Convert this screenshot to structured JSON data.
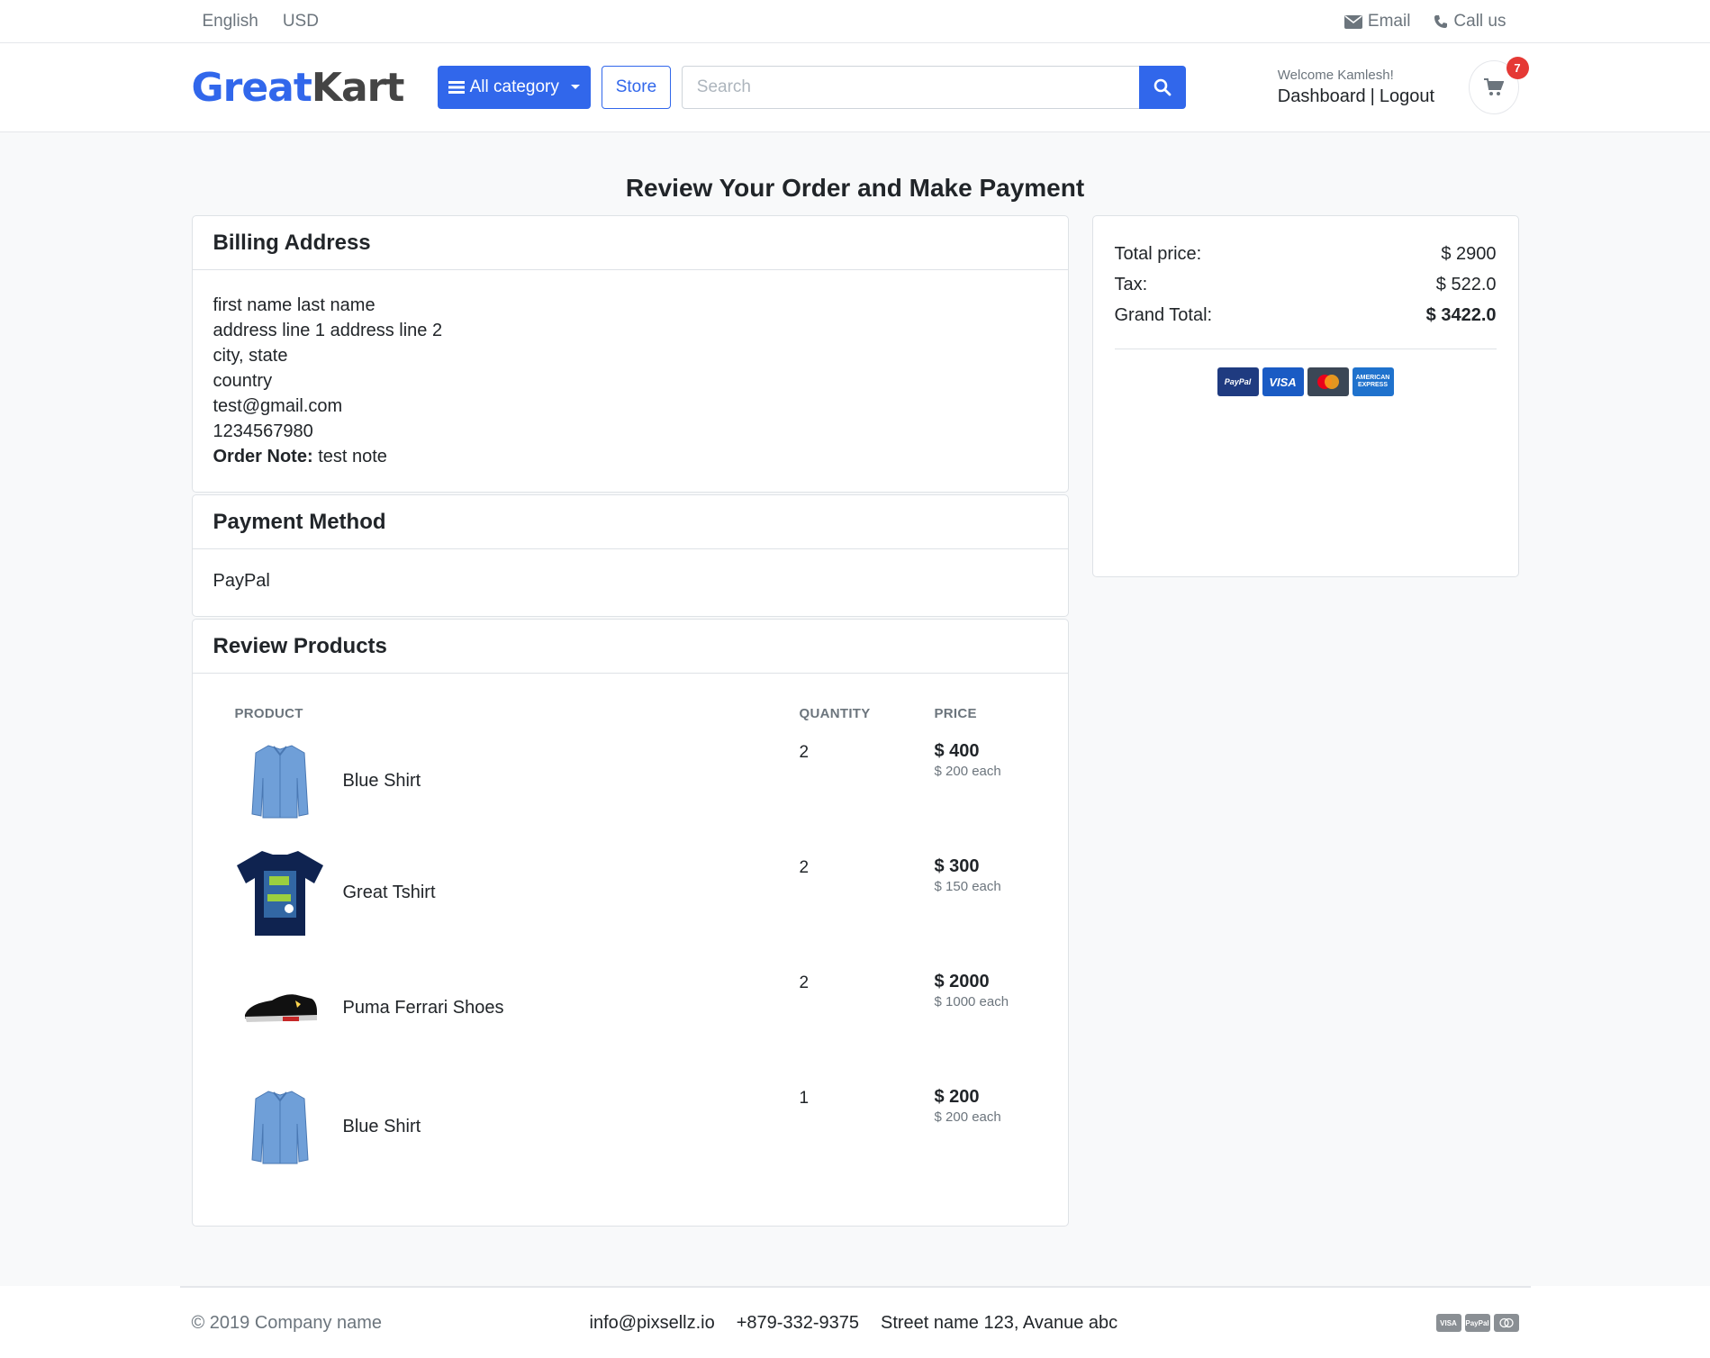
{
  "topbar": {
    "language": "English",
    "currency": "USD",
    "email_label": "Email",
    "call_label": "Call us"
  },
  "header": {
    "logo_part1": "Great",
    "logo_part2": "Kart",
    "category_button": "All category",
    "store_button": "Store",
    "search_placeholder": "Search",
    "welcome": "Welcome Kamlesh!",
    "dashboard": "Dashboard",
    "separator": "|",
    "logout": "Logout",
    "cart_count": "7"
  },
  "page_title": "Review Your Order and Make Payment",
  "billing": {
    "title": "Billing Address",
    "lines": [
      "first name last name",
      "address line 1 address line 2",
      "city, state",
      "country",
      "test@gmail.com",
      "1234567980"
    ],
    "note_label": "Order Note:",
    "note_value": "test note"
  },
  "payment": {
    "title": "Payment Method",
    "value": "PayPal"
  },
  "products": {
    "title": "Review Products",
    "columns": [
      "PRODUCT",
      "QUANTITY",
      "PRICE"
    ],
    "items": [
      {
        "name": "Blue Shirt",
        "qty": "2",
        "price": "$ 400",
        "each": "$ 200 each",
        "icon": "shirt"
      },
      {
        "name": "Great Tshirt",
        "qty": "2",
        "price": "$ 300",
        "each": "$ 150 each",
        "icon": "tshirt"
      },
      {
        "name": "Puma Ferrari Shoes",
        "qty": "2",
        "price": "$ 2000",
        "each": "$ 1000 each",
        "icon": "shoe"
      },
      {
        "name": "Blue Shirt",
        "qty": "1",
        "price": "$ 200",
        "each": "$ 200 each",
        "icon": "shirt"
      }
    ]
  },
  "summary": {
    "total_label": "Total price:",
    "total_value": "$ 2900",
    "tax_label": "Tax:",
    "tax_value": "$ 522.0",
    "grand_label": "Grand Total:",
    "grand_value": "$ 3422.0",
    "card_labels": {
      "paypal": "PayPal",
      "visa": "VISA",
      "amex": "AMERICAN EXPRESS"
    }
  },
  "footer": {
    "copyright": "© 2019 Company name",
    "email": "info@pixsellz.io",
    "phone": "+879-332-9375",
    "address": "Street name 123, Avanue abc",
    "card_labels": {
      "visa": "VISA",
      "paypal": "PayPal"
    }
  },
  "colors": {
    "primary": "#3167eb",
    "badge": "#e53935"
  }
}
